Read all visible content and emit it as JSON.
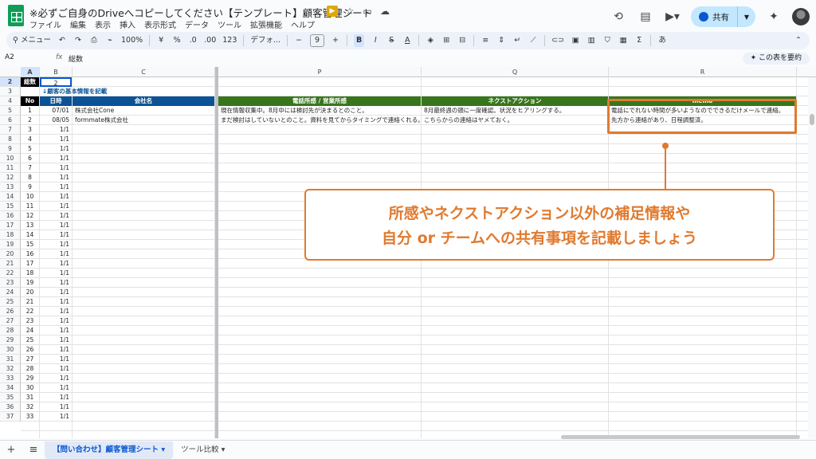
{
  "window": {
    "title": "※必ずご自身のDriveへコピーしてください【テンプレート】顧客管理シート",
    "menu": [
      "ファイル",
      "編集",
      "表示",
      "挿入",
      "表示形式",
      "データ",
      "ツール",
      "拡張機能",
      "ヘルプ"
    ],
    "share_label": "共有"
  },
  "toolbar": {
    "search_label": "メニュー",
    "zoom": "100%",
    "currency": "¥",
    "percent": "%",
    "dec_less": ".0",
    "dec_more": ".00",
    "number_format": "123",
    "font": "デフォ...",
    "font_size": "9",
    "bold": "B",
    "italic": "I",
    "strike": "S",
    "text_color": "A",
    "input_tool": "あ"
  },
  "formula_bar": {
    "cell_ref": "A2",
    "fx": "fx",
    "value": "総数",
    "summary_button": "この表を要約"
  },
  "columns": [
    "A",
    "B",
    "C",
    "P",
    "Q",
    "R"
  ],
  "rows": [
    "2",
    "3",
    "4",
    "5",
    "6",
    "7",
    "8",
    "9",
    "10",
    "11",
    "12",
    "13",
    "14",
    "15",
    "16",
    "17",
    "18",
    "19",
    "20",
    "21",
    "22",
    "23",
    "24",
    "25",
    "26",
    "27",
    "28",
    "29",
    "30",
    "31",
    "32",
    "33",
    "34",
    "35",
    "36",
    "37"
  ],
  "sheet": {
    "total_label": "総数",
    "total_value": "2",
    "section_note": "↓顧客の基本情報を記載",
    "headers": {
      "no": "No",
      "date": "日時",
      "company": "会社名",
      "impression": "電話所感 / 営業所感",
      "next_action": "ネクストアクション",
      "memo": "memo"
    },
    "records": [
      {
        "no": "1",
        "date": "07/01",
        "company": "株式会社Cone",
        "impression": "現在情報収集中。8月中には検討先が決まるとのこと。",
        "next_action": "8月最終週の頭に一度確認。状況をヒアリングする。",
        "memo": "電話にでれない時間が多いようなのでできるだけメールで連絡。"
      },
      {
        "no": "2",
        "date": "08/05",
        "company": "formmate株式会社",
        "impression": "まだ検討はしていないとのこと。資料を見てからタイミングで連絡くれる。",
        "next_action": "こちらからの連絡はヤメておく。",
        "memo": "先方から連絡があり、日程調整済。"
      }
    ],
    "empty_nos": [
      "3",
      "4",
      "5",
      "6",
      "7",
      "8",
      "9",
      "10",
      "11",
      "12",
      "13",
      "14",
      "15",
      "16",
      "17",
      "18",
      "19",
      "20",
      "21",
      "22",
      "23",
      "24",
      "25",
      "26",
      "27",
      "28",
      "29",
      "30",
      "31",
      "32",
      "33"
    ],
    "default_date": "1/1"
  },
  "callout": {
    "line1": "所感やネクストアクション以外の補足情報や",
    "line2": "自分 or チームへの共有事項を記載しましょう",
    "accent": "#e07a2f"
  },
  "tabs": [
    {
      "label": "【問い合わせ】顧客管理シート",
      "active": true
    },
    {
      "label": "ツール比較",
      "active": false
    }
  ],
  "colors": {
    "header_blue": "#0b5394",
    "header_green": "#38761d",
    "selection": "#0b57d0"
  }
}
